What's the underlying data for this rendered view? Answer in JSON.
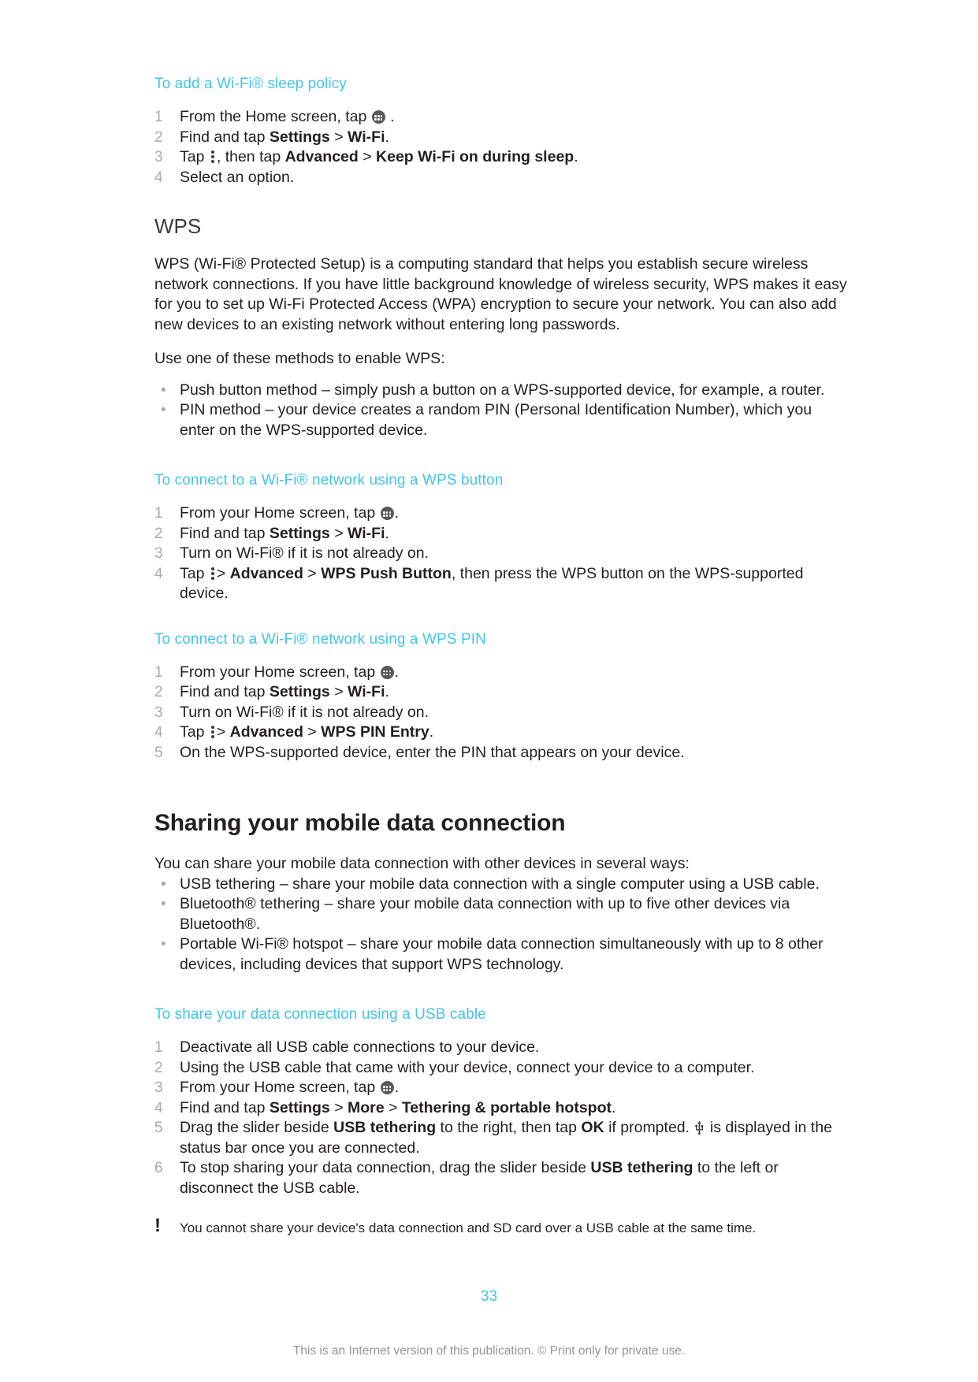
{
  "page": {
    "number": "33",
    "footer_note": "This is an Internet version of this publication. © Print only for private use.",
    "accent_color": "#42c4ea",
    "text_color": "#231f20",
    "muted_color": "#939598"
  },
  "proc_sleep_policy": {
    "title": "To add a Wi-Fi® sleep policy",
    "steps": [
      {
        "num": "1",
        "pre": "From the Home screen, tap ",
        "icon": "app-drawer-icon",
        "post": " ."
      },
      {
        "num": "2",
        "pre": "Find and tap ",
        "bold1": "Settings",
        "sep": " > ",
        "bold2": "Wi-Fi",
        "post": "."
      },
      {
        "num": "3",
        "pre": "Tap ",
        "icon": "kebab-menu-icon",
        "mid": ", then tap ",
        "bold1": "Advanced",
        "sep": " > ",
        "bold2": "Keep Wi-Fi on during sleep",
        "post": "."
      },
      {
        "num": "4",
        "pre": "Select an option."
      }
    ]
  },
  "wps": {
    "heading": "WPS",
    "paragraph1": "WPS (Wi-Fi® Protected Setup) is a computing standard that helps you establish secure wireless network connections. If you have little background knowledge of wireless security, WPS makes it easy for you to set up Wi-Fi Protected Access (WPA) encryption to secure your network. You can also add new devices to an existing network without entering long passwords.",
    "paragraph2": "Use one of these methods to enable WPS:",
    "bullets": [
      "Push button method – simply push a button on a WPS-supported device, for example, a router.",
      "PIN method – your device creates a random PIN (Personal Identification Number), which you enter on the WPS-supported device."
    ]
  },
  "proc_wps_button": {
    "title": "To connect to a Wi-Fi® network using a WPS button",
    "steps": [
      {
        "num": "1",
        "pre": "From your Home screen, tap ",
        "icon": "app-drawer-icon",
        "post": "."
      },
      {
        "num": "2",
        "pre": "Find and tap ",
        "bold1": "Settings",
        "sep": " > ",
        "bold2": "Wi-Fi",
        "post": "."
      },
      {
        "num": "3",
        "pre": "Turn on Wi-Fi® if it is not already on."
      },
      {
        "num": "4",
        "pre": "Tap ",
        "icon": "kebab-menu-icon",
        "mid": "> ",
        "bold1": "Advanced",
        "sep": " > ",
        "bold2": "WPS Push Button",
        "post": ", then press the WPS button on the WPS-supported device."
      }
    ]
  },
  "proc_wps_pin": {
    "title": "To connect to a Wi-Fi® network using a WPS PIN",
    "steps": [
      {
        "num": "1",
        "pre": "From your Home screen, tap ",
        "icon": "app-drawer-icon",
        "post": "."
      },
      {
        "num": "2",
        "pre": "Find and tap ",
        "bold1": "Settings",
        "sep": " > ",
        "bold2": "Wi-Fi",
        "post": "."
      },
      {
        "num": "3",
        "pre": "Turn on Wi-Fi® if it is not already on."
      },
      {
        "num": "4",
        "pre": "Tap ",
        "icon": "kebab-menu-icon",
        "mid": "> ",
        "bold1": "Advanced",
        "sep": " > ",
        "bold2": "WPS PIN Entry",
        "post": "."
      },
      {
        "num": "5",
        "pre": "On the WPS-supported device, enter the PIN that appears on your device."
      }
    ]
  },
  "sharing": {
    "heading": "Sharing your mobile data connection",
    "intro": "You can share your mobile data connection with other devices in several ways:",
    "bullets": [
      "USB tethering – share your mobile data connection with a single computer using a USB cable.",
      "Bluetooth® tethering – share your mobile data connection with up to five other devices via Bluetooth®.",
      "Portable Wi-Fi® hotspot – share your mobile data connection simultaneously with up to 8 other devices, including devices that support WPS technology."
    ]
  },
  "proc_usb_share": {
    "title": "To share your data connection using a USB cable",
    "steps": [
      {
        "num": "1",
        "pre": "Deactivate all USB cable connections to your device."
      },
      {
        "num": "2",
        "pre": "Using the USB cable that came with your device, connect your device to a computer."
      },
      {
        "num": "3",
        "pre": "From your Home screen, tap ",
        "icon": "app-drawer-icon",
        "post": "."
      },
      {
        "num": "4",
        "pre": "Find and tap ",
        "bold1": "Settings",
        "sep": " > ",
        "bold2": "More",
        "sep2": " > ",
        "bold3": "Tethering & portable hotspot",
        "post": "."
      },
      {
        "num": "5",
        "pre": "Drag the slider beside ",
        "bold1": "USB tethering",
        "mid": " to the right, then tap ",
        "bold2": "OK",
        "mid2": " if prompted. ",
        "icon": "usb-icon",
        "post": " is displayed in the status bar once you are connected."
      },
      {
        "num": "6",
        "pre": "To stop sharing your data connection, drag the slider beside ",
        "bold1": "USB tethering",
        "post": " to the left or disconnect the USB cable."
      }
    ]
  },
  "note": {
    "marker": "!",
    "text": "You cannot share your device's data connection and SD card over a USB cable at the same time."
  }
}
